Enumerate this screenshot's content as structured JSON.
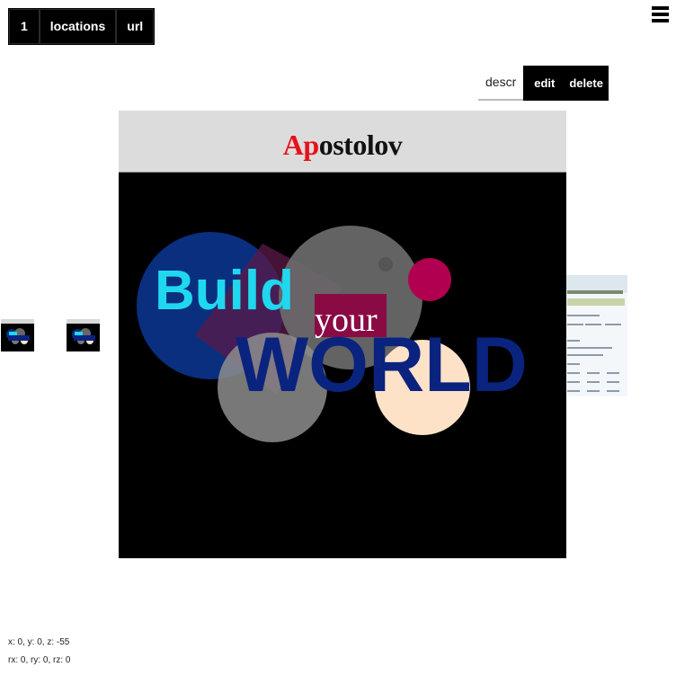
{
  "nav": {
    "items": [
      {
        "label": "1"
      },
      {
        "label": "locations"
      },
      {
        "label": "url"
      }
    ]
  },
  "actions": {
    "descr_label": "descr",
    "edit_label": "edit",
    "delete_label": "delete"
  },
  "frame": {
    "title_accent": "Ap",
    "title_rest": "ostolov",
    "art": {
      "word_build": "Build",
      "word_your": "your",
      "word_world": "WORLD"
    }
  },
  "coords": {
    "position": "x: 0, y: 0, z: -55",
    "rotation": "rx: 0, ry: 0, rz: 0"
  },
  "colors": {
    "build_text": "#1fd8f0",
    "world_text": "#0a237f",
    "title_accent": "#e8101a",
    "magenta": "#b0004f",
    "peach": "#fde2c8",
    "navy_circle": "#0a2f7f"
  },
  "icons": {
    "menu": "hamburger-menu-icon"
  }
}
